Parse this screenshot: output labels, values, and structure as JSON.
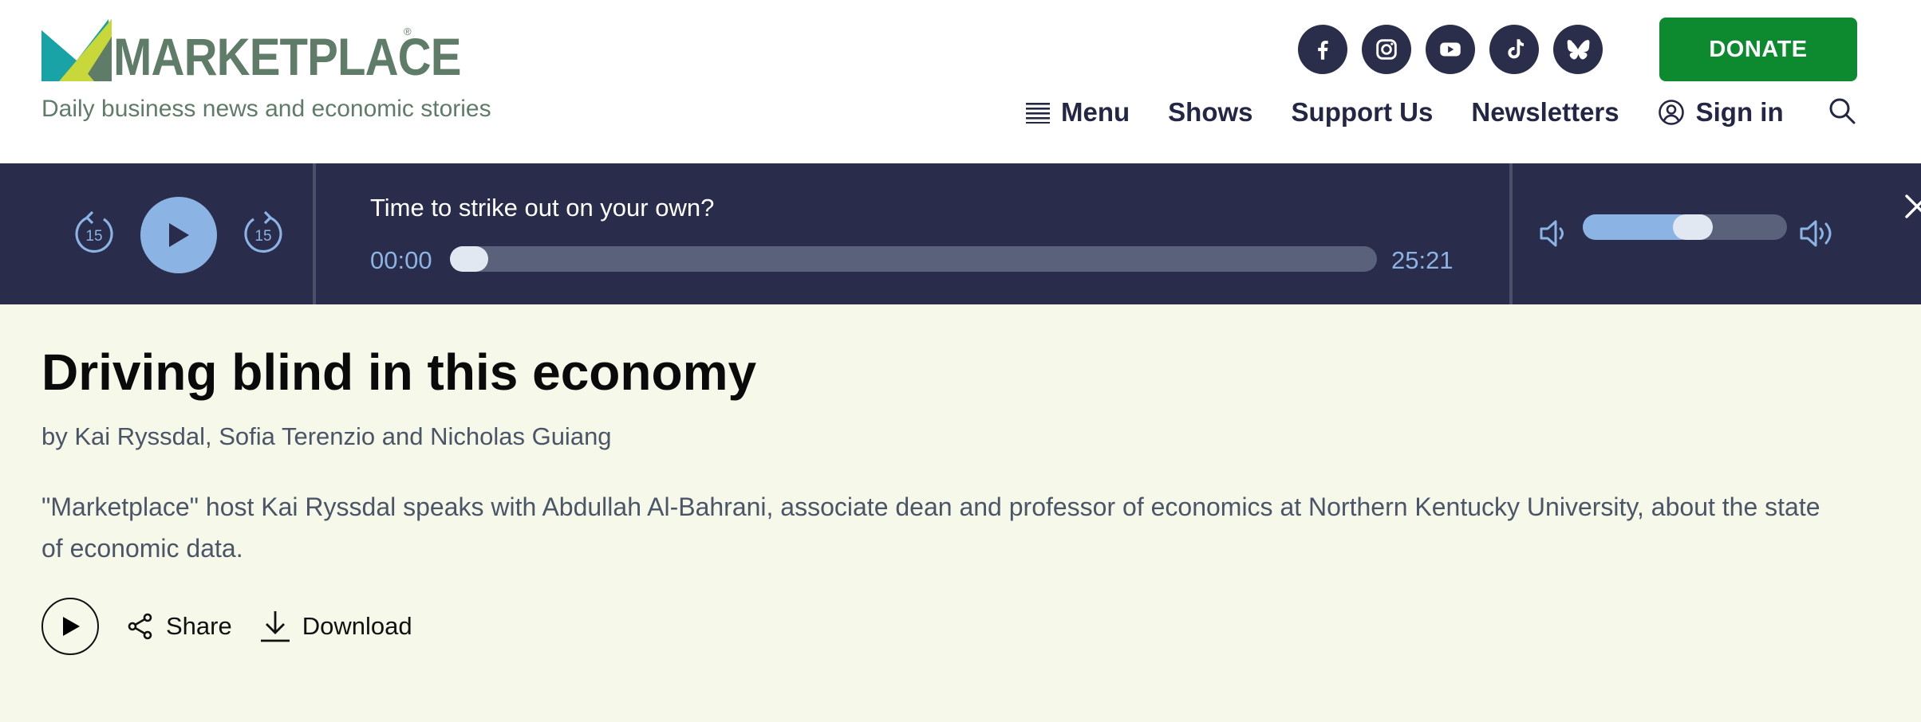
{
  "brand": {
    "name": "MARKETPLACE",
    "registered": "®",
    "tagline": "Daily business news and economic stories",
    "colors": {
      "green_text": "#5f7c68",
      "logo_teal": "#1aa3a6",
      "logo_lime": "#c8d83a",
      "donate_green": "#0d8a2f",
      "navy": "#292c4a"
    }
  },
  "socials": [
    {
      "icon": "facebook-icon"
    },
    {
      "icon": "instagram-icon"
    },
    {
      "icon": "youtube-icon"
    },
    {
      "icon": "tiktok-icon"
    },
    {
      "icon": "bluesky-icon"
    }
  ],
  "donate_label": "DONATE",
  "nav": {
    "menu": "Menu",
    "shows": "Shows",
    "support": "Support Us",
    "newsletters": "Newsletters",
    "signin": "Sign in"
  },
  "player": {
    "skip_back_label": "15",
    "skip_forward_label": "15",
    "track_title": "Time to strike out on your own?",
    "current_time": "00:00",
    "total_time": "25:21",
    "progress_fraction": 0.0,
    "volume_fraction": 0.55
  },
  "article": {
    "headline": "Driving blind in this economy",
    "byline": "by Kai Ryssdal, Sofia Terenzio and Nicholas Guiang",
    "summary": "\"Marketplace\" host Kai Ryssdal speaks with Abdullah Al-Bahrani, associate dean and professor of economics at Northern Kentucky University, about the state of economic data.",
    "share_label": "Share",
    "download_label": "Download"
  }
}
